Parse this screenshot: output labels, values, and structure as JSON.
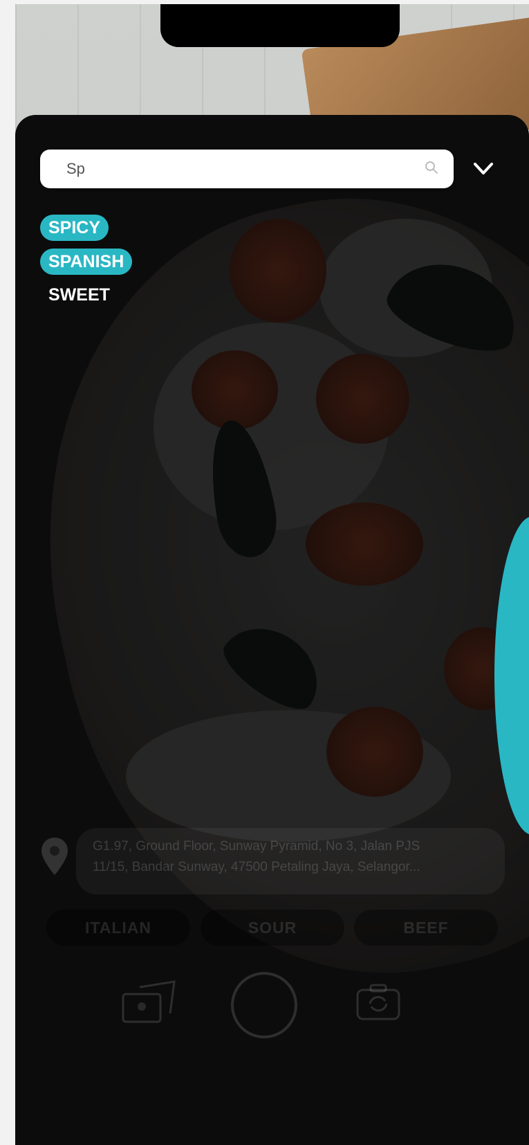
{
  "search": {
    "value": "Sp"
  },
  "tags": [
    {
      "label": "SPICY",
      "selected": true
    },
    {
      "label": "SPANISH",
      "selected": true
    },
    {
      "label": "SWEET",
      "selected": false
    }
  ],
  "address": {
    "line1": "G1.97, Ground Floor, Sunway Pyramid, No 3, Jalan PJS",
    "line2": "11/15, Bandar Sunway, 47500 Petaling Jaya, Selangor..."
  },
  "chips": [
    "ITALIAN",
    "SOUR",
    "BEEF"
  ],
  "colors": {
    "accent": "#2ab7c4",
    "sheet": "#151515"
  },
  "icons": {
    "search": "search-icon",
    "dropdown": "chevron-down-icon",
    "location": "location-pin-icon",
    "gallery": "gallery-icon",
    "shutter": "shutter-button",
    "switch_camera": "switch-camera-icon"
  }
}
